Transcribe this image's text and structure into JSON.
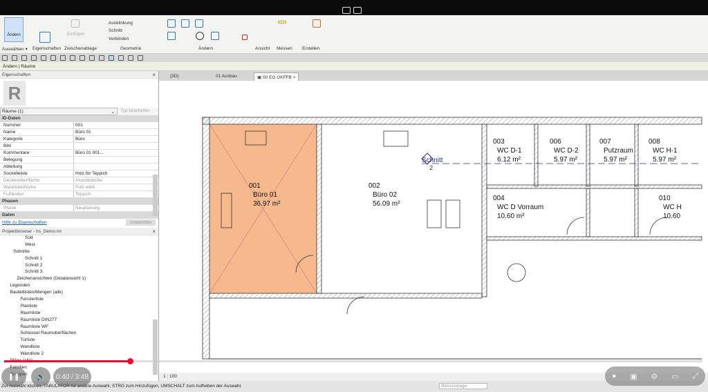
{
  "ribbon": {
    "modify_btn": "Ändern",
    "tools": {
      "notch": "Ausklinkung",
      "cut": "Schnitt",
      "join": "Verbinden",
      "paste": "Einfügen"
    },
    "panels": [
      "Auswählen ▾",
      "Eigenschaften",
      "Zwischenablage",
      "Geometrie",
      "Ändern",
      "Ansicht",
      "Messen",
      "Erstellen"
    ]
  },
  "context_bar": "Ändern | Räume",
  "properties": {
    "title": "Eigenschaften",
    "type_selector": "Räume (1)",
    "edit_type": "Typ bearbeiten",
    "groups": {
      "id": "ID-Daten",
      "phases": "Phasen",
      "data": "Daten"
    },
    "rows": [
      {
        "k": "Nummer",
        "v": "001"
      },
      {
        "k": "Name",
        "v": "Büro 01"
      },
      {
        "k": "Kategorie",
        "v": "Büro"
      },
      {
        "k": "Bild",
        "v": ""
      },
      {
        "k": "Kommentare",
        "v": "Büro 01 001..."
      },
      {
        "k": "Belegung",
        "v": ""
      },
      {
        "k": "Abteilung",
        "v": ""
      },
      {
        "k": "Sockelleiste",
        "v": "Holz für Teppich"
      },
      {
        "k": "Deckenoberfläche",
        "v": "Akustikdecke"
      },
      {
        "k": "Wandoberfläche",
        "v": "Putz weiß"
      },
      {
        "k": "Fußboden",
        "v": "Teppich"
      }
    ],
    "phase_row": {
      "k": "Phase",
      "v": "Neuplanung"
    },
    "help_link": "Hilfe zu Eigenschaften",
    "apply": "Anwenden"
  },
  "browser": {
    "title": "Projektbrowser - hs_Demo.rvt",
    "items": [
      "Süd",
      "West",
      "Schnitte",
      "Schnitt 1",
      "Schnitt 2",
      "Schnitt 3",
      "Zeichenansichten (Detailansicht 1)",
      "Legenden",
      "Bauteillisten/Mengen (alle)",
      "Fensterliste",
      "Planliste",
      "Raumliste",
      "Raumliste DIN277",
      "Raumliste WF",
      "Schlüssel Raumoberflächen",
      "Türliste",
      "Wandliste",
      "Wandliste 2",
      "Pläne (alle)",
      "Familien",
      "Gruppen"
    ]
  },
  "tabs": [
    {
      "label": "{3D}"
    },
    {
      "label": "01 Ausbau"
    },
    {
      "label": "00 EG OKFFB",
      "active": true
    }
  ],
  "plan": {
    "rooms": [
      {
        "num": "001",
        "name": "Büro 01",
        "area": "36.97 m²"
      },
      {
        "num": "002",
        "name": "Büro 02",
        "area": "56.09 m²"
      },
      {
        "num": "003",
        "name": "WC D-1",
        "area": "6.12 m²"
      },
      {
        "num": "006",
        "name": "WC D-2",
        "area": "5.97 m²"
      },
      {
        "num": "007",
        "name": "Putzraum",
        "area": "5.97 m²"
      },
      {
        "num": "008",
        "name": "WC H-1",
        "area": "5.97 m²"
      },
      {
        "num": "004",
        "name": "WC D Vorraum",
        "area": "10.60 m²"
      },
      {
        "num": "010",
        "name": "WC H",
        "area": "10.60"
      }
    ],
    "section": {
      "label": "Schnitt",
      "num": "2"
    },
    "selected_fill": "#f5b98d"
  },
  "viewbar": {
    "scale": "1 : 100"
  },
  "status": {
    "text": "Zur Auswahl klicken, TABULATOR für andere Auswahl, STRG zum Hinzufügen, UMSCHALT zum Aufheben der Auswahl.",
    "workset": "Basisvorlage"
  },
  "video": {
    "time": "0:40 / 3:48",
    "progress": 0.18
  }
}
